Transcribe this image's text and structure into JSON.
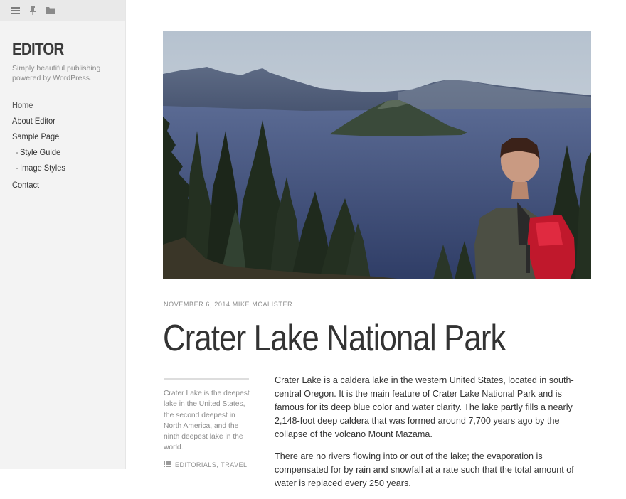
{
  "sidebar": {
    "toolbar": [
      {
        "icon": "menu-icon"
      },
      {
        "icon": "pin-icon"
      },
      {
        "icon": "folder-icon"
      }
    ],
    "site_title": "EDITOR",
    "tagline": "Simply beautiful publishing powered by WordPress.",
    "menu": [
      {
        "label": "Home",
        "level": 0
      },
      {
        "label": "About Editor",
        "level": 0
      },
      {
        "label": "Sample Page",
        "level": 0
      },
      {
        "label": "Style Guide",
        "level": 1
      },
      {
        "label": "Image Styles",
        "level": 1
      },
      {
        "label": "Contact",
        "level": 0
      }
    ]
  },
  "post": {
    "date": "NOVEMBER 6, 2014",
    "author": "MIKE MCALISTER",
    "title": "Crater Lake National Park",
    "excerpt": "Crater Lake is the deepest lake in the United States, the second deepest in North America, and the ninth deepest lake in the world.",
    "categories": [
      "EDITORIALS",
      "TRAVEL"
    ],
    "paragraphs": [
      "Crater Lake is a caldera lake in the western United States, located in south-central Oregon. It is the main feature of Crater Lake National Park and is famous for its deep blue color and water clarity. The lake partly fills a nearly 2,148-foot deep caldera that was formed around 7,700 years ago by the collapse of the volcano Mount Mazama.",
      "There are no rivers flowing into or out of the lake; the evaporation is compensated for by rain and snowfall at a rate such that the total amount of water is replaced every 250 years."
    ]
  },
  "colors": {
    "sidebar_bg": "#f3f3f3",
    "toolbar_bg": "#e9e9e9",
    "text": "#333333",
    "muted": "#8d8d8d",
    "sky": "#cdd6df",
    "lake": "#3f4f78",
    "trees": "#1f2a1d",
    "backpack": "#c0182c"
  }
}
